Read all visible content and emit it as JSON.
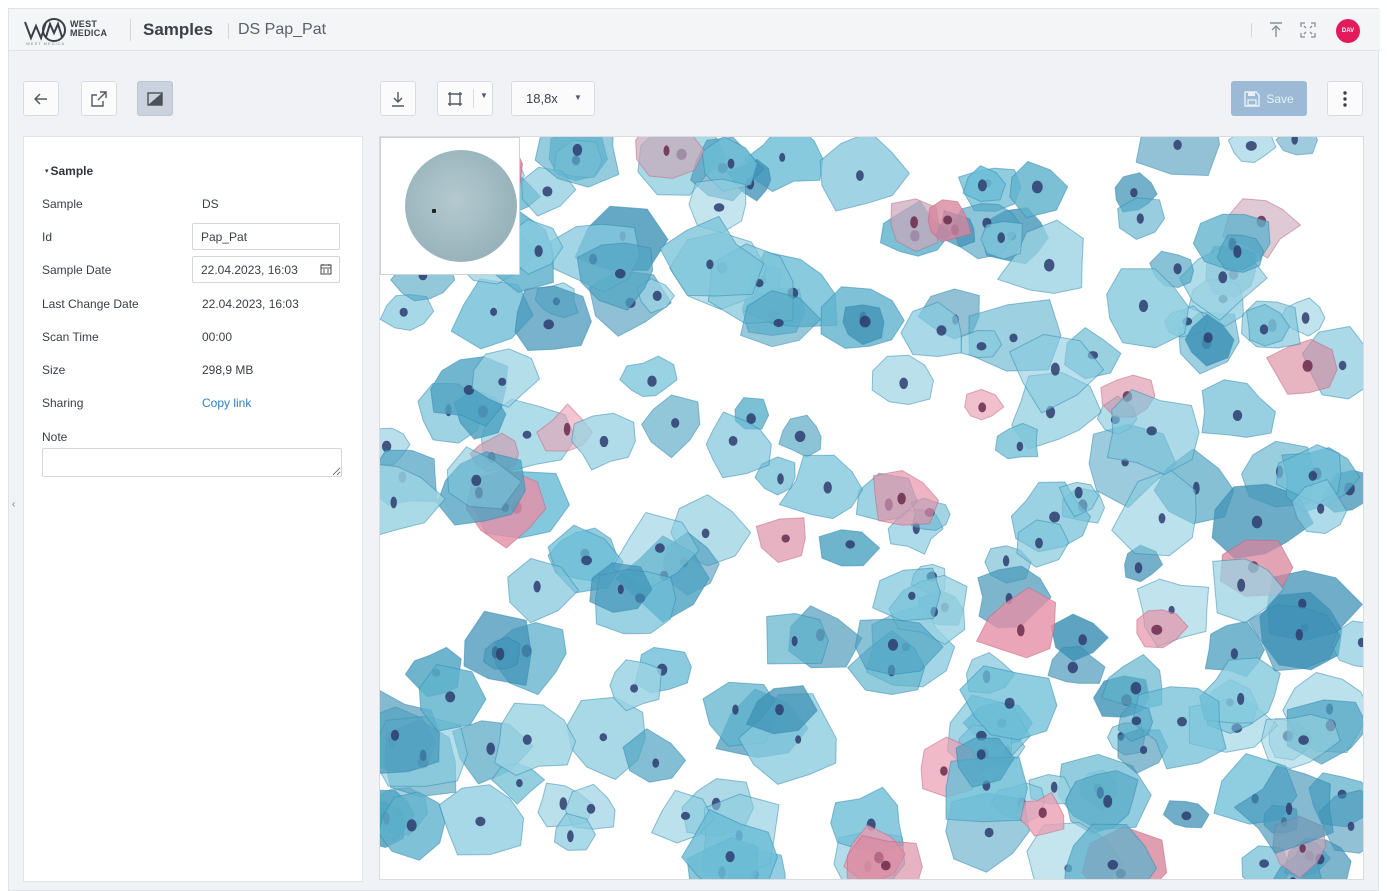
{
  "header": {
    "brand_line1": "WEST",
    "brand_line2": "MEDICA",
    "brand_sub": "WEST MEDICA",
    "breadcrumb_section": "Samples",
    "breadcrumb_item": "DS Pap_Pat",
    "avatar_initials": "DAV"
  },
  "toolbar": {
    "zoom_value": "18,8x",
    "save_label": "Save"
  },
  "sample_panel": {
    "section_title": "Sample",
    "rows": [
      {
        "label": "Sample",
        "value": "DS"
      },
      {
        "label": "Id",
        "value": "Pap_Pat"
      },
      {
        "label": "Sample Date",
        "value": "22.04.2023, 16:03"
      },
      {
        "label": "Last Change Date",
        "value": "22.04.2023, 16:03"
      },
      {
        "label": "Scan Time",
        "value": "00:00"
      },
      {
        "label": "Size",
        "value": "298,9 MB"
      },
      {
        "label": "Sharing",
        "value": "Copy link"
      }
    ],
    "note_label": "Note",
    "note_value": ""
  },
  "colors": {
    "accent_link": "#2f7fc1",
    "avatar_bg": "#e31b5c",
    "save_button_disabled": "#9cbad6",
    "cell_blue": "#5fb2cc",
    "cell_pink": "#e58fa6",
    "nucleus": "#2e3c6e"
  }
}
